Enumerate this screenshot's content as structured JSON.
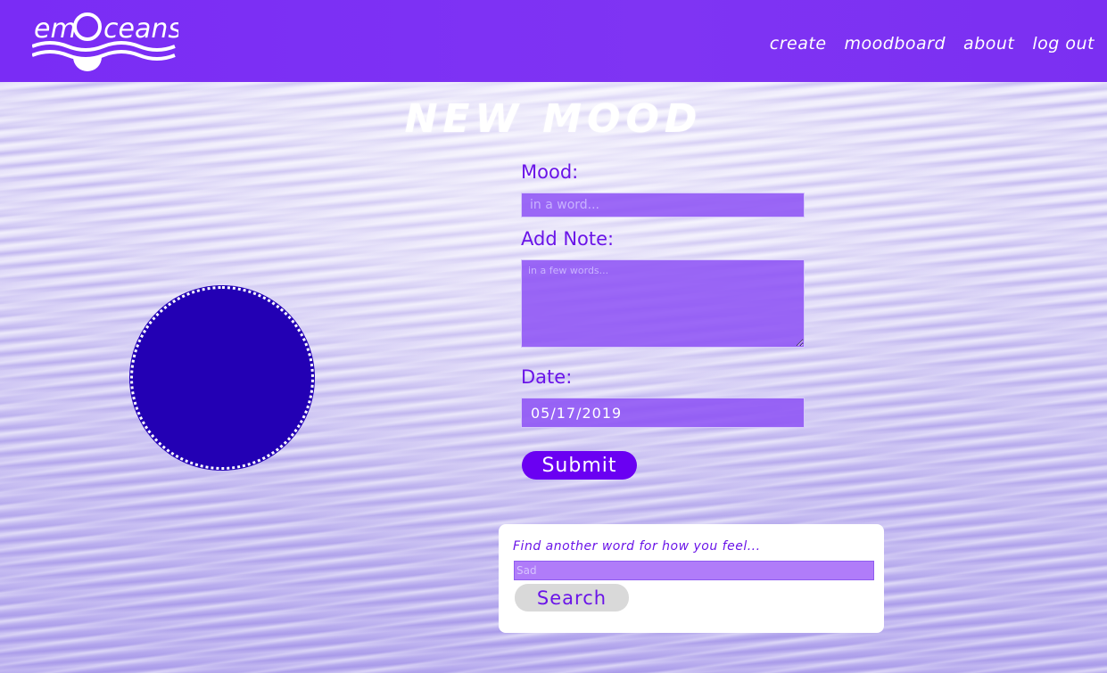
{
  "header": {
    "logo_text": "emOceans",
    "nav": [
      {
        "label": "create"
      },
      {
        "label": "moodboard"
      },
      {
        "label": "about"
      },
      {
        "label": "log out"
      }
    ]
  },
  "main": {
    "title": "NEW MOOD",
    "mood_label": "Mood:",
    "mood_placeholder": "in a word...",
    "note_label": "Add Note:",
    "note_placeholder": "in a few words...",
    "date_label": "Date:",
    "date_value": "05/17/2019",
    "submit_label": "Submit",
    "mood_color": "#2300b4"
  },
  "search": {
    "prompt": "Find another word for how you feel...",
    "placeholder": "Sad",
    "button_label": "Search"
  },
  "colors": {
    "header": "#7a2cf5",
    "accent": "#6a14e8",
    "field": "#8c50f5"
  }
}
